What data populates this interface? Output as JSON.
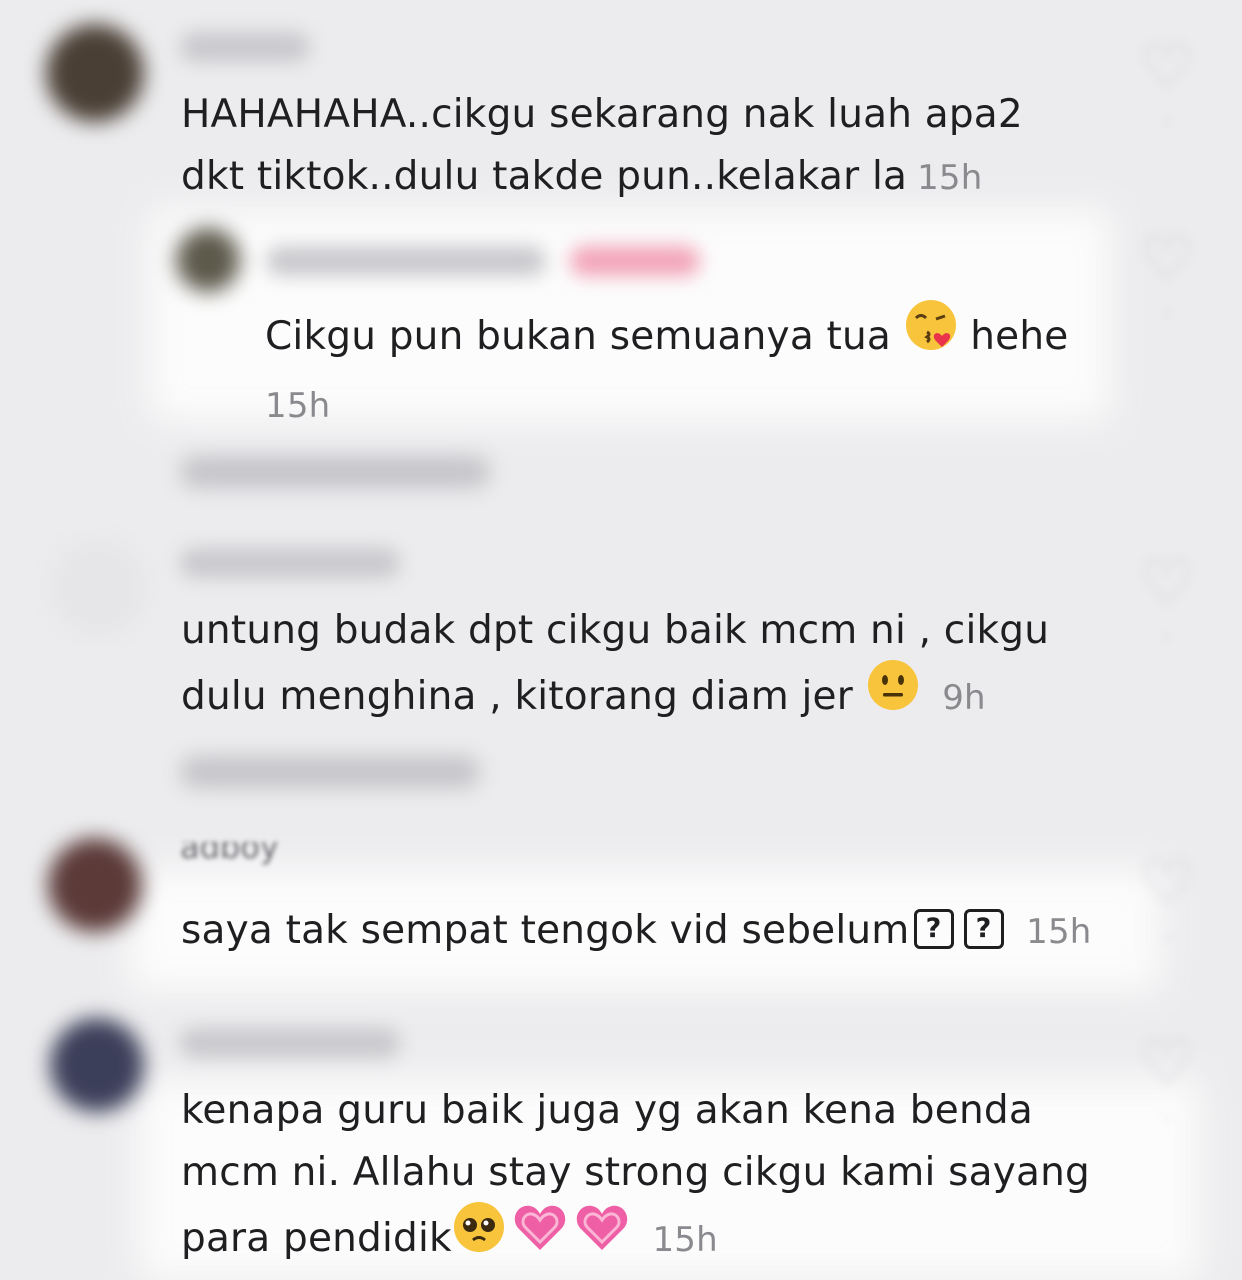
{
  "comments": [
    {
      "text_lines": [
        "HAHAHAHA..cikgu sekarang nak luah apa2",
        "dkt tiktok..dulu takde pun..kelakar la"
      ],
      "time": "15h"
    },
    {
      "reply_text": "Cikgu pun bukan semuanya tua",
      "reply_text_after": "hehe",
      "time": "15h"
    },
    {
      "text_lines": [
        "untung budak dpt cikgu baik mcm ni , cikgu",
        "dulu menghina , kitorang diam jer"
      ],
      "time": "9h"
    },
    {
      "username_partial": "adboy",
      "text": "saya tak sempat tengok vid sebelum",
      "unknown_glyph": "?",
      "time": "15h"
    },
    {
      "text_lines": [
        "kenapa guru baik juga yg akan kena benda",
        "mcm ni. Allahu stay strong cikgu kami sayang",
        "para pendidik"
      ],
      "time": "15h"
    }
  ],
  "icons": {
    "like": "heart-outline-icon",
    "emoji_kiss": "face-blowing-kiss-emoji",
    "emoji_neutral": "neutral-face-emoji",
    "emoji_pleading": "pleading-face-emoji",
    "emoji_heart": "growing-heart-emoji"
  },
  "colors": {
    "background": "#ececee",
    "text": "#1f1f22",
    "timestamp": "#8a8a8e",
    "creator_badge": "#f2a4b9"
  }
}
